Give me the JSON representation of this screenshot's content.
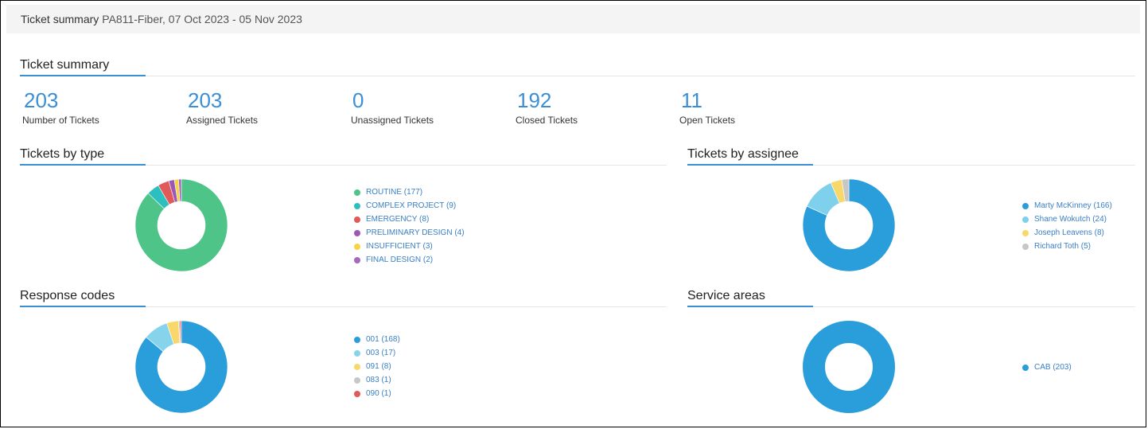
{
  "header": {
    "title": "Ticket summary",
    "subtitle": "PA811-Fiber, 07 Oct 2023 - 05 Nov 2023"
  },
  "summary": {
    "title": "Ticket summary",
    "stats": [
      {
        "value": "203",
        "label": "Number of Tickets"
      },
      {
        "value": "203",
        "label": "Assigned Tickets"
      },
      {
        "value": "0",
        "label": "Unassigned Tickets"
      },
      {
        "value": "192",
        "label": "Closed Tickets"
      },
      {
        "value": "11",
        "label": "Open Tickets"
      }
    ]
  },
  "colors": {
    "accent": "#3a8fd6"
  },
  "chart_data": [
    {
      "type": "pie",
      "title": "Tickets by type",
      "categories": [
        "ROUTINE (177)",
        "COMPLEX PROJECT (9)",
        "EMERGENCY (8)",
        "PRELIMINARY DESIGN (4)",
        "INSUFFICIENT (3)",
        "FINAL DESIGN (2)"
      ],
      "values": [
        177,
        9,
        8,
        4,
        3,
        2
      ],
      "colors": [
        "#4fc488",
        "#2bbfbf",
        "#e05a5a",
        "#9b59b6",
        "#f5d547",
        "#a569bd"
      ],
      "legend": "right"
    },
    {
      "type": "pie",
      "title": "Tickets by assignee",
      "categories": [
        "Marty McKinney (166)",
        "Shane Wokutch (24)",
        "Joseph Leavens (8)",
        "Richard Toth (5)"
      ],
      "values": [
        166,
        24,
        8,
        5
      ],
      "colors": [
        "#2a9ddb",
        "#7fd0ec",
        "#f8d86a",
        "#c7c7c7"
      ],
      "legend": "right"
    },
    {
      "type": "pie",
      "title": "Response codes",
      "categories": [
        "001 (168)",
        "003 (17)",
        "091 (8)",
        "083 (1)",
        "090 (1)"
      ],
      "values": [
        168,
        17,
        8,
        1,
        1
      ],
      "colors": [
        "#2a9ddb",
        "#86d3ec",
        "#f8d86a",
        "#c7c7c7",
        "#e05a5a"
      ],
      "legend": "right"
    },
    {
      "type": "pie",
      "title": "Service areas",
      "categories": [
        "CAB (203)"
      ],
      "values": [
        203
      ],
      "colors": [
        "#2a9ddb"
      ],
      "legend": "right"
    }
  ]
}
